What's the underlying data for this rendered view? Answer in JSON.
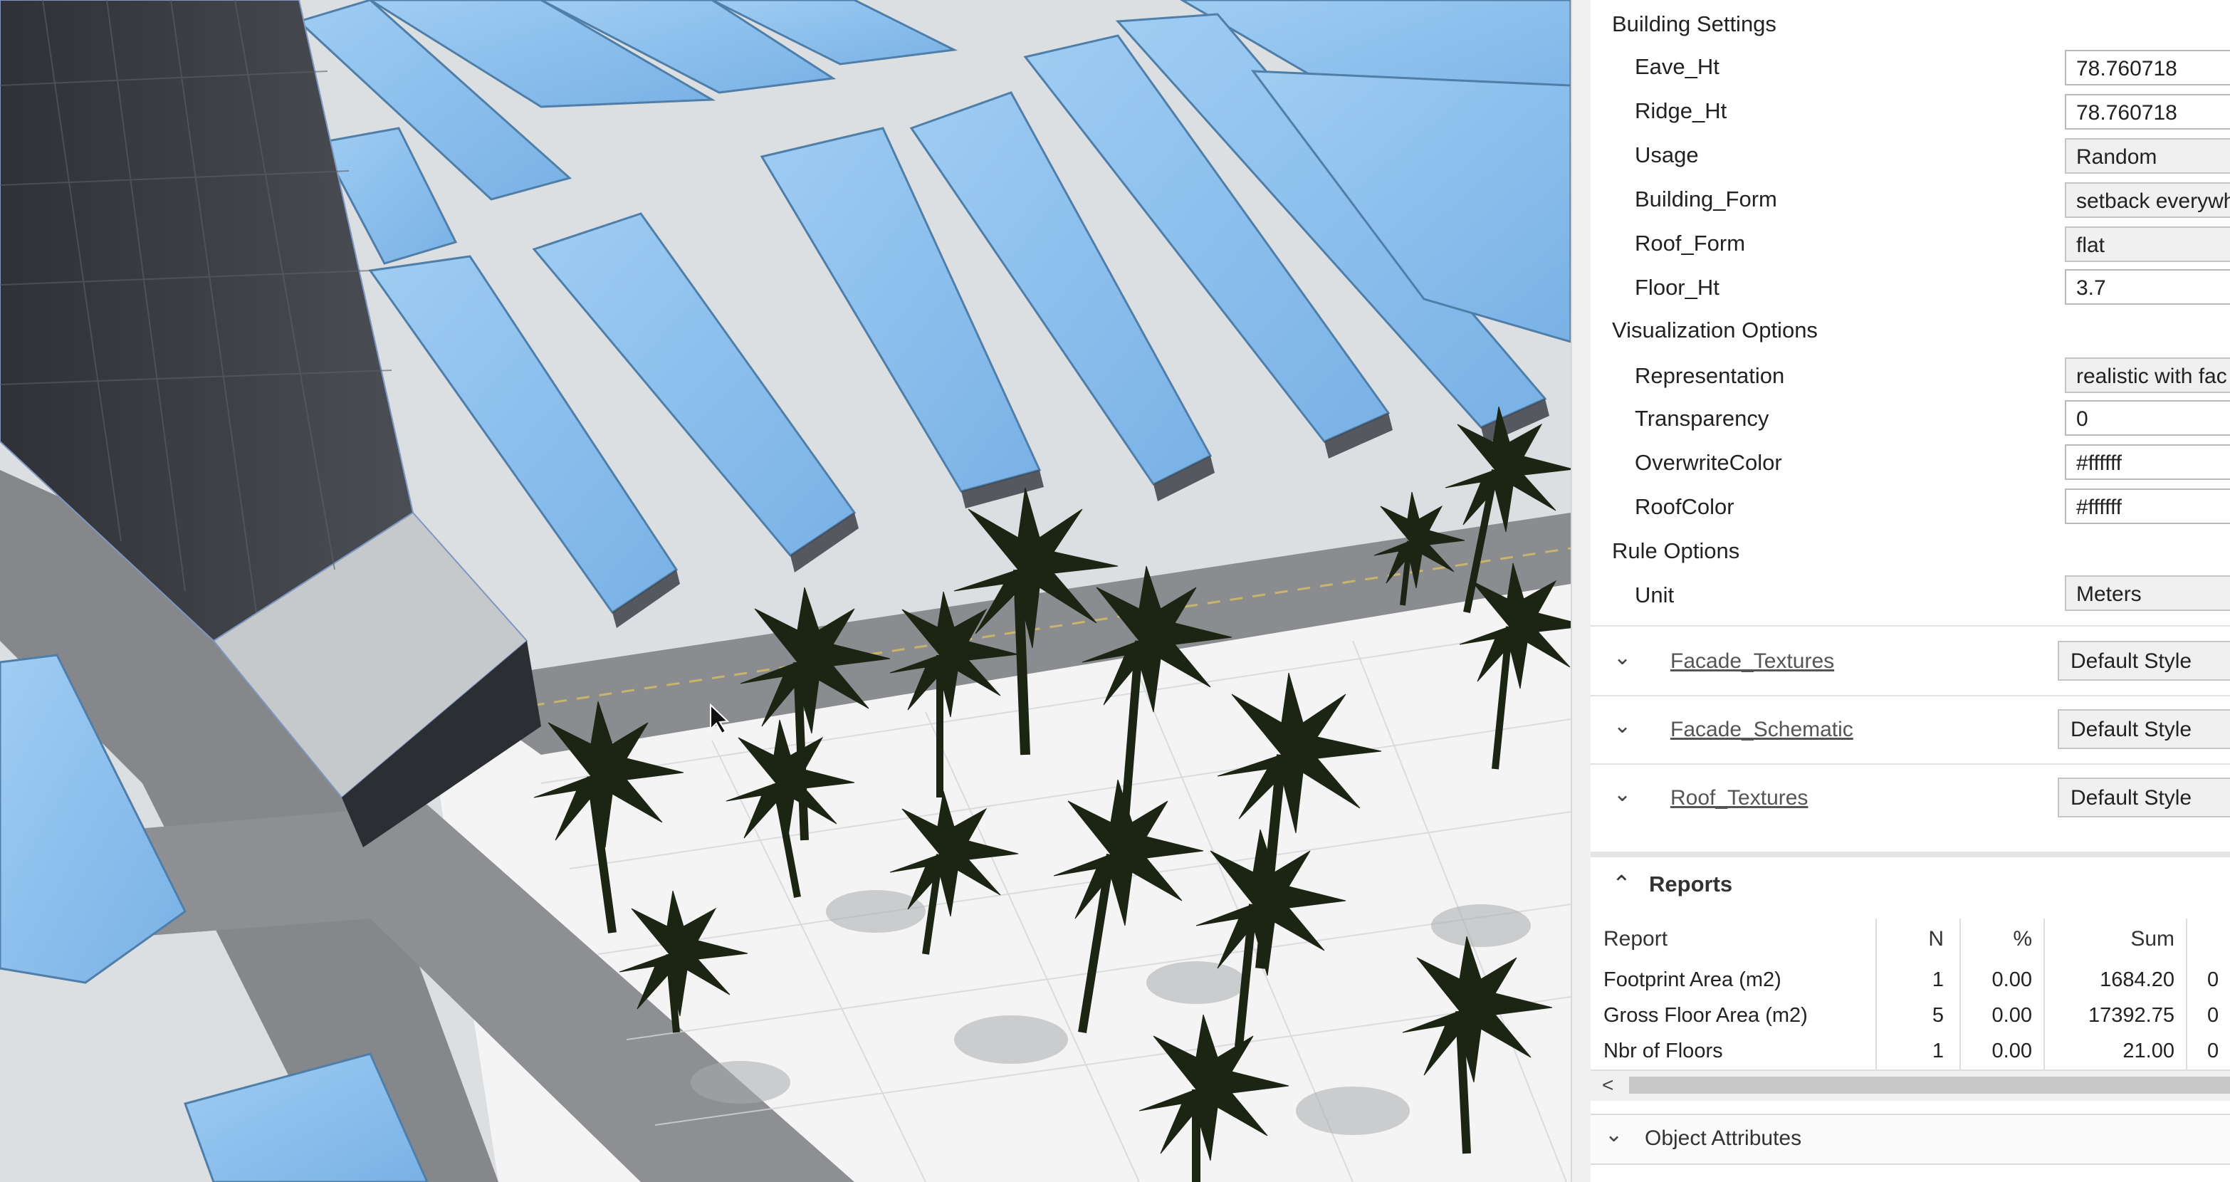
{
  "inspector": {
    "building_settings": {
      "title": "Building Settings",
      "rows": [
        {
          "label": "Eave_Ht",
          "value": "78.760718"
        },
        {
          "label": "Ridge_Ht",
          "value": "78.760718"
        },
        {
          "label": "Usage",
          "value": "Random"
        },
        {
          "label": "Building_Form",
          "value": "setback everywh"
        },
        {
          "label": "Roof_Form",
          "value": "flat"
        },
        {
          "label": "Floor_Ht",
          "value": "3.7"
        }
      ]
    },
    "visualization_options": {
      "title": "Visualization Options",
      "rows": [
        {
          "label": "Representation",
          "value": "realistic with fac"
        },
        {
          "label": "Transparency",
          "value": "0"
        },
        {
          "label": "OverwriteColor",
          "value": "#ffffff"
        },
        {
          "label": "RoofColor",
          "value": "#ffffff"
        }
      ]
    },
    "rule_options": {
      "title": "Rule Options",
      "rows": [
        {
          "label": "Unit",
          "value": "Meters"
        }
      ]
    },
    "styles": [
      {
        "name": "Facade_Textures",
        "value": "Default Style"
      },
      {
        "name": "Facade_Schematic",
        "value": "Default Style"
      },
      {
        "name": "Roof_Textures",
        "value": "Default Style"
      }
    ],
    "reports": {
      "title": "Reports",
      "columns": [
        "Report",
        "N",
        "%",
        "Sum"
      ],
      "rows": [
        {
          "report": "Footprint Area (m2)",
          "n": "1",
          "pct": "0.00",
          "sum": "1684.20",
          "extra": "0"
        },
        {
          "report": "Gross Floor Area (m2)",
          "n": "5",
          "pct": "0.00",
          "sum": "17392.75",
          "extra": "0"
        },
        {
          "report": "Nbr of Floors",
          "n": "1",
          "pct": "0.00",
          "sum": "21.00",
          "extra": "0"
        }
      ]
    },
    "object_attributes": {
      "title": "Object Attributes"
    }
  },
  "colors": {
    "roof_blue": "#8ec3ef",
    "roof_blue_dark": "#5f98cf",
    "building_wall": "#3c3f44",
    "ground": "#e9eaeb",
    "road": "#8b8c8e",
    "palm": "#1c2414"
  }
}
